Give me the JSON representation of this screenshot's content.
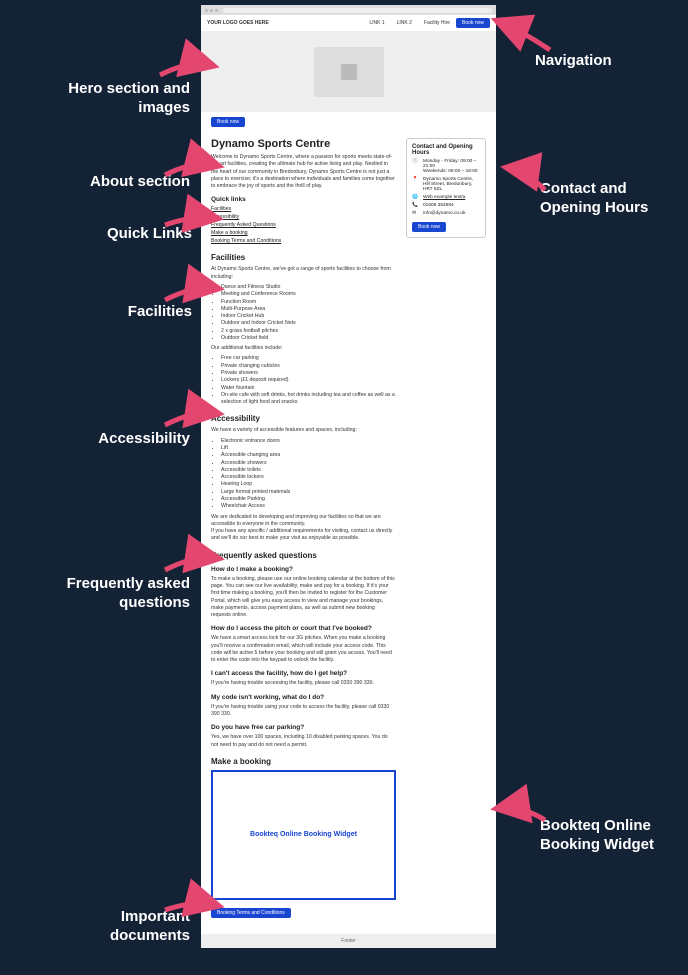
{
  "header": {
    "logo": "YOUR LOGO GOES HERE",
    "links": [
      "LINK 1",
      "LINK 2",
      "Facility Hire"
    ],
    "book": "Book now"
  },
  "hero_book": "Book now",
  "title": "Dynamo Sports Centre",
  "welcome": "Welcome to Dynamo Sports Centre, where a passion for sports meets state-of-the-art facilities, creating the ultimate hub for active living and play. Nestled in the heart of our community in Bredonbury, Dynamo Sports Centre is not just a place to exercise; it's a destination where individuals and families come together to embrace the joy of sports and the thrill of play.",
  "quick_links_heading": "Quick links",
  "quick_links": [
    "Facilities",
    "Accessibility",
    "Frequently Asked Questions",
    "Make a booking",
    "Booking Terms and Conditions"
  ],
  "facilities_heading": "Facilities",
  "facilities_intro": "At Dynamo Sports Centre, we've got a range of sports facilities to choose from including:",
  "facilities_list": [
    "Dance and Fitness Studio",
    "Meeting and Conference Rooms",
    "Function Room",
    "Multi-Purpose Area",
    "Indoor Cricket Hub",
    "Outdoor and Indoor Cricket Nets",
    "2 x grass football pitches",
    "Outdoor Cricket field"
  ],
  "additional_intro": "Our additional facilities include:",
  "additional_list": [
    "Free car parking",
    "Private changing cubicles",
    "Private showers",
    "Lockers (£1 deposit required)",
    "Water fountain",
    "On-site cafe with soft drinks, hot drinks including tea and coffee as well as a selection of light food and snacks"
  ],
  "accessibility_heading": "Accessibility",
  "accessibility_intro": "We have a variety of accessible features and spaces, including:",
  "accessibility_list": [
    "Electronic entrance doors",
    "Lift",
    "Accessible changing area",
    "Accessible showers",
    "Accessible toilets",
    "Accessible lockers",
    "Hearing Loop",
    "Large format printed materials",
    "Accessible Parking",
    "Wheelchair Access"
  ],
  "accessibility_p1": "We are dedicated to developing and improving our facilities so that we are accessible to everyone in the community.",
  "accessibility_p2": "If you have any specific / additional requirements for visiting, contact us directly and we'll do our best to make your visit as enjoyable as possible.",
  "faq_heading": "Frequently asked questions",
  "faq": [
    {
      "q": "How do I make a booking?",
      "a": "To make a booking, please use our online booking calendar at the bottom of this page. You can see our live availability, make and pay for a booking. If it's your first time making a booking, you'll then be invited to register for the Customer Portal, which will give you easy access to view and manage your bookings, make payments, access payment plans, as well as submit new booking requests online."
    },
    {
      "q": "How do I access the pitch or court that I've booked?",
      "a": "We have a smart access lock for our 3G pitches. When you make a booking you'll receive a confirmation email, which will include your access code. This code will be active 5 before your booking and will grant you access. You'll need to enter the code into the keypad to unlock the facility."
    },
    {
      "q": "I can't access the facility, how do I get help?",
      "a": "If you're having trouble accessing the facility, please call 0330 390 330."
    },
    {
      "q": "My code isn't working, what do I do?",
      "a": "If you're having trouble using your code to access the facility, please call 0330 390 330."
    },
    {
      "q": "Do you have free car parking?",
      "a": "Yes, we have over 100 spaces, including 10 disabled parking spaces. You do not need to pay and do not need a permit."
    }
  ],
  "make_booking_heading": "Make a booking",
  "booking_widget": "Bookteq Online Booking Widget",
  "doc_button": "Booking Terms and Conditions",
  "footer": "Footer",
  "side": {
    "heading": "Contact and Opening Hours",
    "hours_line1": "Monday - Friday: 09:00 – 21:00",
    "hours_line2": "Weekends: 09:00 – 18:00",
    "address": "Dynamo Sports Centre, Hill Street, Bredonbury, HR7 5ZL",
    "website": "Web example text/a",
    "phone": "01608 352684",
    "email": "info@dynamo.co.uk",
    "book": "Book now"
  },
  "annotations": {
    "nav": "Navigation",
    "hero": "Hero section and images",
    "about": "About section",
    "contact": "Contact and Opening Hours",
    "quick": "Quick Links",
    "facilities": "Facilities",
    "accessibility": "Accessibility",
    "faq": "Frequently asked questions",
    "booking": "Bookteq Online Booking Widget",
    "docs": "Important documents"
  }
}
